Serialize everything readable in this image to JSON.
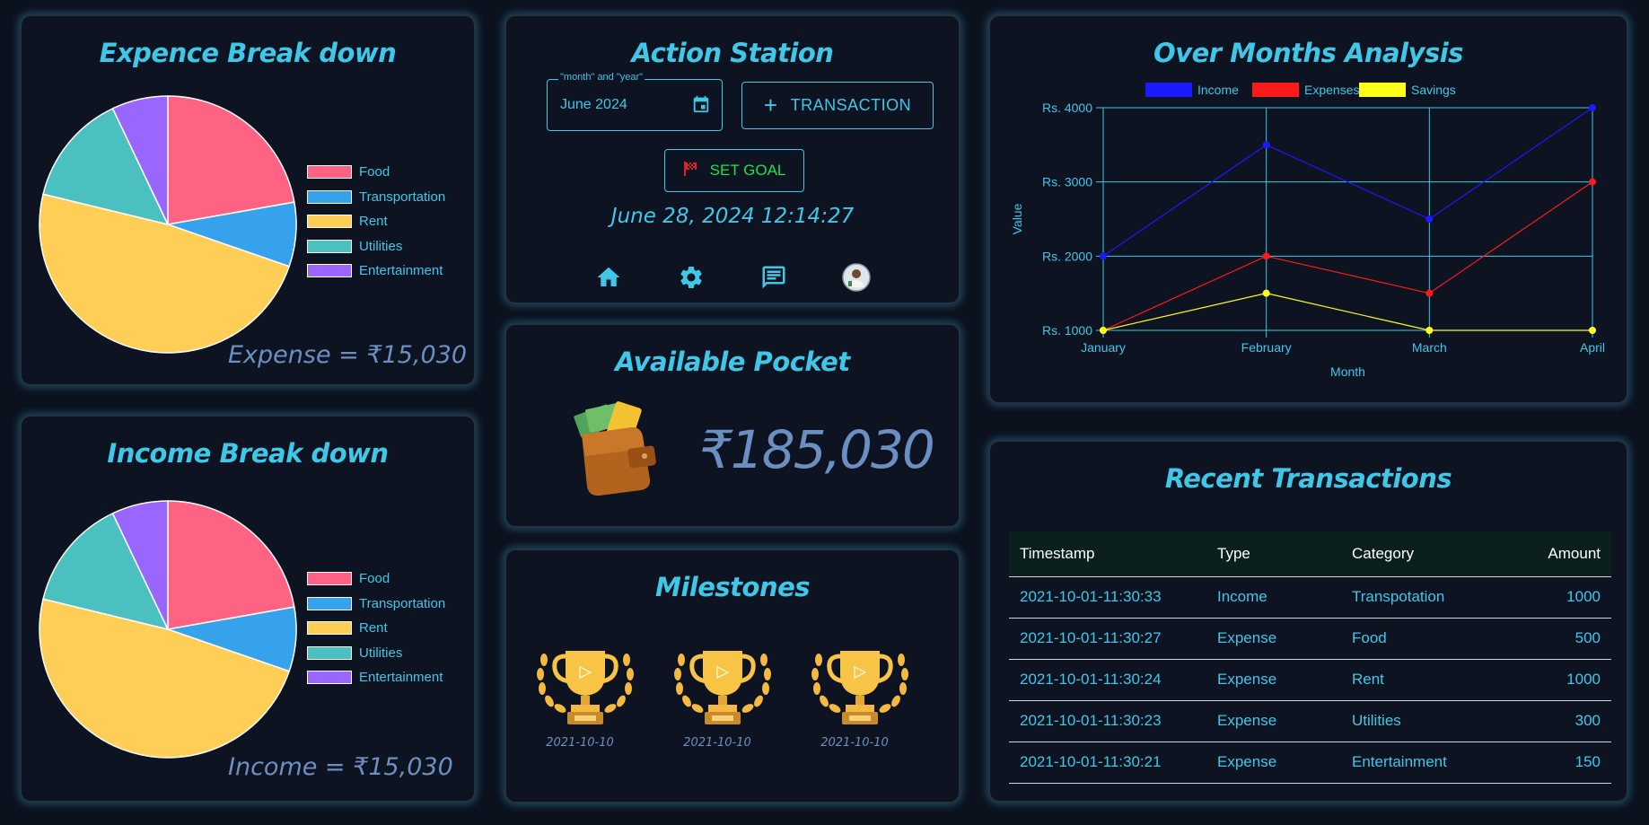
{
  "expense_panel": {
    "title": "Expence Break down",
    "total": "Expense = ₹15,030",
    "legend": [
      "Food",
      "Transportation",
      "Rent",
      "Utilities",
      "Entertainment"
    ]
  },
  "income_panel": {
    "title": "Income Break down",
    "total": "Income = ₹15,030",
    "legend": [
      "Food",
      "Transportation",
      "Rent",
      "Utilities",
      "Entertainment"
    ]
  },
  "action_station": {
    "title": "Action Station",
    "date_field_label": "\"month\" and \"year\"",
    "date_field_value": "June 2024",
    "transaction_label": "TRANSACTION",
    "set_goal_label": "SET GOAL",
    "datetime": "June 28, 2024 12:14:27",
    "nav_icons": [
      "home-icon",
      "gear-icon",
      "chat-icon",
      "avatar"
    ]
  },
  "pocket": {
    "title": "Available Pocket",
    "amount": "₹185,030"
  },
  "milestones": {
    "title": "Milestones",
    "dates": [
      "2021-10-10",
      "2021-10-10",
      "2021-10-10"
    ]
  },
  "analysis": {
    "title": "Over Months Analysis"
  },
  "transactions": {
    "title": "Recent Transactions",
    "headers": [
      "Timestamp",
      "Type",
      "Category",
      "Amount"
    ],
    "rows": [
      [
        "2021-10-01-11:30:33",
        "Income",
        "Transpotation",
        "1000"
      ],
      [
        "2021-10-01-11:30:27",
        "Expense",
        "Food",
        "500"
      ],
      [
        "2021-10-01-11:30:24",
        "Expense",
        "Rent",
        "1000"
      ],
      [
        "2021-10-01-11:30:23",
        "Expense",
        "Utilities",
        "300"
      ],
      [
        "2021-10-01-11:30:21",
        "Expense",
        "Entertainment",
        "150"
      ]
    ]
  },
  "colors": {
    "accent": "#3fc7e8",
    "background": "#0c111e",
    "muted_text": "#6b8fc0",
    "set_goal": "#19e05a"
  },
  "chart_data": [
    {
      "type": "pie",
      "categories": [
        "Food",
        "Transportation",
        "Rent",
        "Utilities",
        "Entertainment"
      ],
      "values": [
        22,
        8,
        48,
        14,
        7
      ],
      "colors": [
        "#ff6384",
        "#36a2eb",
        "#ffce56",
        "#4bc0c0",
        "#9966ff"
      ]
    },
    {
      "type": "pie",
      "categories": [
        "Food",
        "Transportation",
        "Rent",
        "Utilities",
        "Entertainment"
      ],
      "values": [
        22,
        8,
        48,
        14,
        7
      ],
      "colors": [
        "#ff6384",
        "#36a2eb",
        "#ffce56",
        "#4bc0c0",
        "#9966ff"
      ]
    },
    {
      "type": "line",
      "categories": [
        "January",
        "February",
        "March",
        "April"
      ],
      "series": [
        {
          "name": "Income",
          "values": [
            2000,
            3500,
            2500,
            4000
          ],
          "color": "#1a1aff"
        },
        {
          "name": "Expenses",
          "values": [
            1000,
            2000,
            1500,
            3000
          ],
          "color": "#ff1a1a"
        },
        {
          "name": "Savings",
          "values": [
            1000,
            1500,
            1000,
            1000
          ],
          "color": "#ffff1a"
        }
      ],
      "xlabel": "Month",
      "ylabel": "Value",
      "yticks": [
        "Rs. 1000",
        "Rs. 2000",
        "Rs. 3000",
        "Rs. 4000"
      ],
      "ylim": [
        1000,
        4000
      ],
      "grid": true,
      "legend": "top"
    }
  ]
}
